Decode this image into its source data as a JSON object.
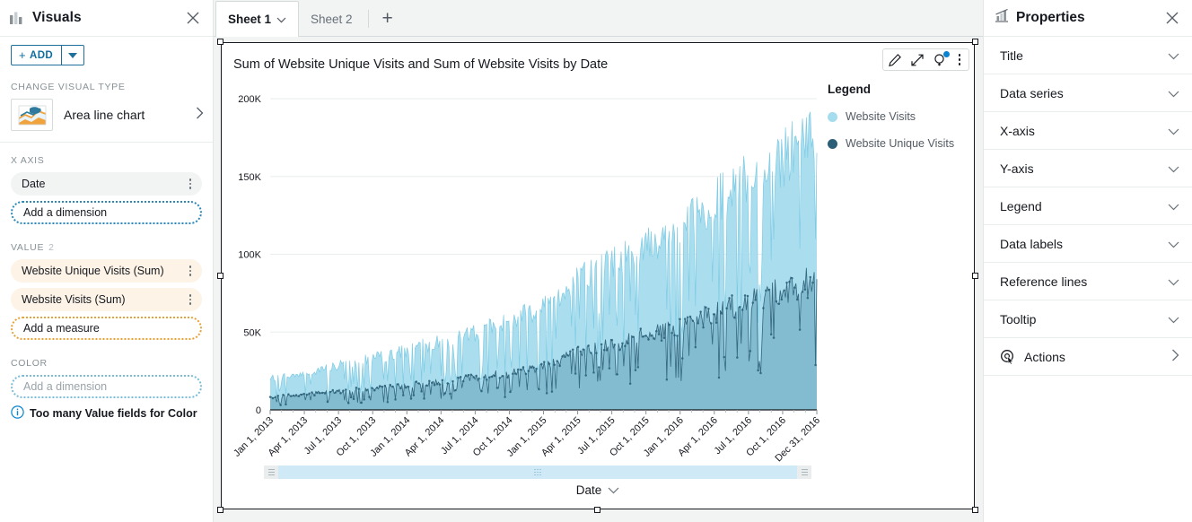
{
  "visuals_panel": {
    "title": "Visuals",
    "header_icon": "bar-chart-icon",
    "close_icon": "close-icon",
    "add_button": {
      "label": "ADD",
      "plus": "+",
      "caret_icon": "chevron-down-icon"
    },
    "change_visual_type_label": "CHANGE VISUAL TYPE",
    "visual_type": {
      "name": "Area line chart",
      "thumb_icon": "area-line-chart-icon",
      "chevron": "chevron-right-icon"
    },
    "x_axis": {
      "label": "X AXIS",
      "fields": [
        {
          "label": "Date",
          "menu_icon": "kebab-menu-icon"
        }
      ],
      "placeholder": "Add a dimension"
    },
    "value": {
      "label": "VALUE",
      "count": "2",
      "fields": [
        {
          "label": "Website Unique Visits (Sum)",
          "menu_icon": "kebab-menu-icon"
        },
        {
          "label": "Website Visits (Sum)",
          "menu_icon": "kebab-menu-icon"
        }
      ],
      "placeholder": "Add a measure"
    },
    "color": {
      "label": "COLOR",
      "placeholder": "Add a dimension",
      "note": "Too many Value fields for Color",
      "note_icon": "info-icon"
    }
  },
  "sheets": {
    "tabs": [
      {
        "label": "Sheet 1",
        "active": true,
        "caret_icon": "chevron-down-icon"
      },
      {
        "label": "Sheet 2",
        "active": false
      }
    ],
    "add_tab_label": "+"
  },
  "visual": {
    "title": "Sum of Website Unique Visits and Sum of Website Visits by Date",
    "toolbar": [
      {
        "name": "edit-pencil-icon"
      },
      {
        "name": "maximize-icon"
      },
      {
        "name": "insight-bulb-icon",
        "badge": true
      },
      {
        "name": "kebab-menu-icon"
      }
    ],
    "x_axis_footer": {
      "label": "Date",
      "caret_icon": "chevron-down-icon"
    },
    "scrollbar": {
      "left_icon": "resize-handle-icon",
      "right_icon": "resize-handle-icon",
      "grip_icon": "drag-grip-icon"
    }
  },
  "properties_panel": {
    "title": "Properties",
    "header_icon": "chart-properties-icon",
    "close_icon": "close-icon",
    "rows": [
      {
        "label": "Title",
        "chevron": "chevron-down-icon"
      },
      {
        "label": "Data series",
        "chevron": "chevron-down-icon"
      },
      {
        "label": "X-axis",
        "chevron": "chevron-down-icon"
      },
      {
        "label": "Y-axis",
        "chevron": "chevron-down-icon"
      },
      {
        "label": "Legend",
        "chevron": "chevron-down-icon"
      },
      {
        "label": "Data labels",
        "chevron": "chevron-down-icon"
      },
      {
        "label": "Reference lines",
        "chevron": "chevron-down-icon"
      },
      {
        "label": "Tooltip",
        "chevron": "chevron-down-icon"
      },
      {
        "label": "Actions",
        "chevron": "chevron-right-icon",
        "icon": "actions-target-icon"
      }
    ]
  },
  "colors": {
    "website_visits": "#a5dcee",
    "website_unique_visits": "#2c5f77",
    "unique_area": "#9cc6d6",
    "accent_blue": "#0f6c9e",
    "orange_pill": "#fdf3e6"
  },
  "chart_data": {
    "type": "area",
    "title": "Sum of Website Unique Visits and Sum of Website Visits by Date",
    "xlabel": "Date",
    "ylabel": "",
    "ylim": [
      0,
      200000
    ],
    "ytick_labels": [
      "0",
      "50K",
      "100K",
      "150K",
      "200K"
    ],
    "ytick_values": [
      0,
      50000,
      100000,
      150000,
      200000
    ],
    "grid": true,
    "legend_title": "Legend",
    "legend_position": "right",
    "x_range": [
      "Jan 1, 2013",
      "Dec 31, 2016"
    ],
    "xtick_labels": [
      "Jan 1, 2013",
      "Apr 1, 2013",
      "Jul 1, 2013",
      "Oct 1, 2013",
      "Jan 1, 2014",
      "Apr 1, 2014",
      "Jul 1, 2014",
      "Oct 1, 2014",
      "Jan 1, 2015",
      "Apr 1, 2015",
      "Jul 1, 2015",
      "Oct 1, 2015",
      "Jan 1, 2016",
      "Apr 1, 2016",
      "Jul 1, 2016",
      "Oct 1, 2016",
      "Dec 31, 2016"
    ],
    "series": [
      {
        "name": "Website Visits",
        "color": "#a5dcee",
        "quarterly_envelope_values": [
          22000,
          26000,
          31000,
          36000,
          42000,
          48000,
          55000,
          62000,
          74000,
          92000,
          104000,
          114000,
          128000,
          148000,
          162000,
          178000,
          192000
        ]
      },
      {
        "name": "Website Unique Visits",
        "color": "#2c5f77",
        "quarterly_envelope_values": [
          9000,
          11000,
          13000,
          15000,
          17000,
          20000,
          23000,
          26000,
          31000,
          40000,
          47000,
          52000,
          59000,
          68000,
          76000,
          84000,
          92000
        ]
      }
    ]
  }
}
